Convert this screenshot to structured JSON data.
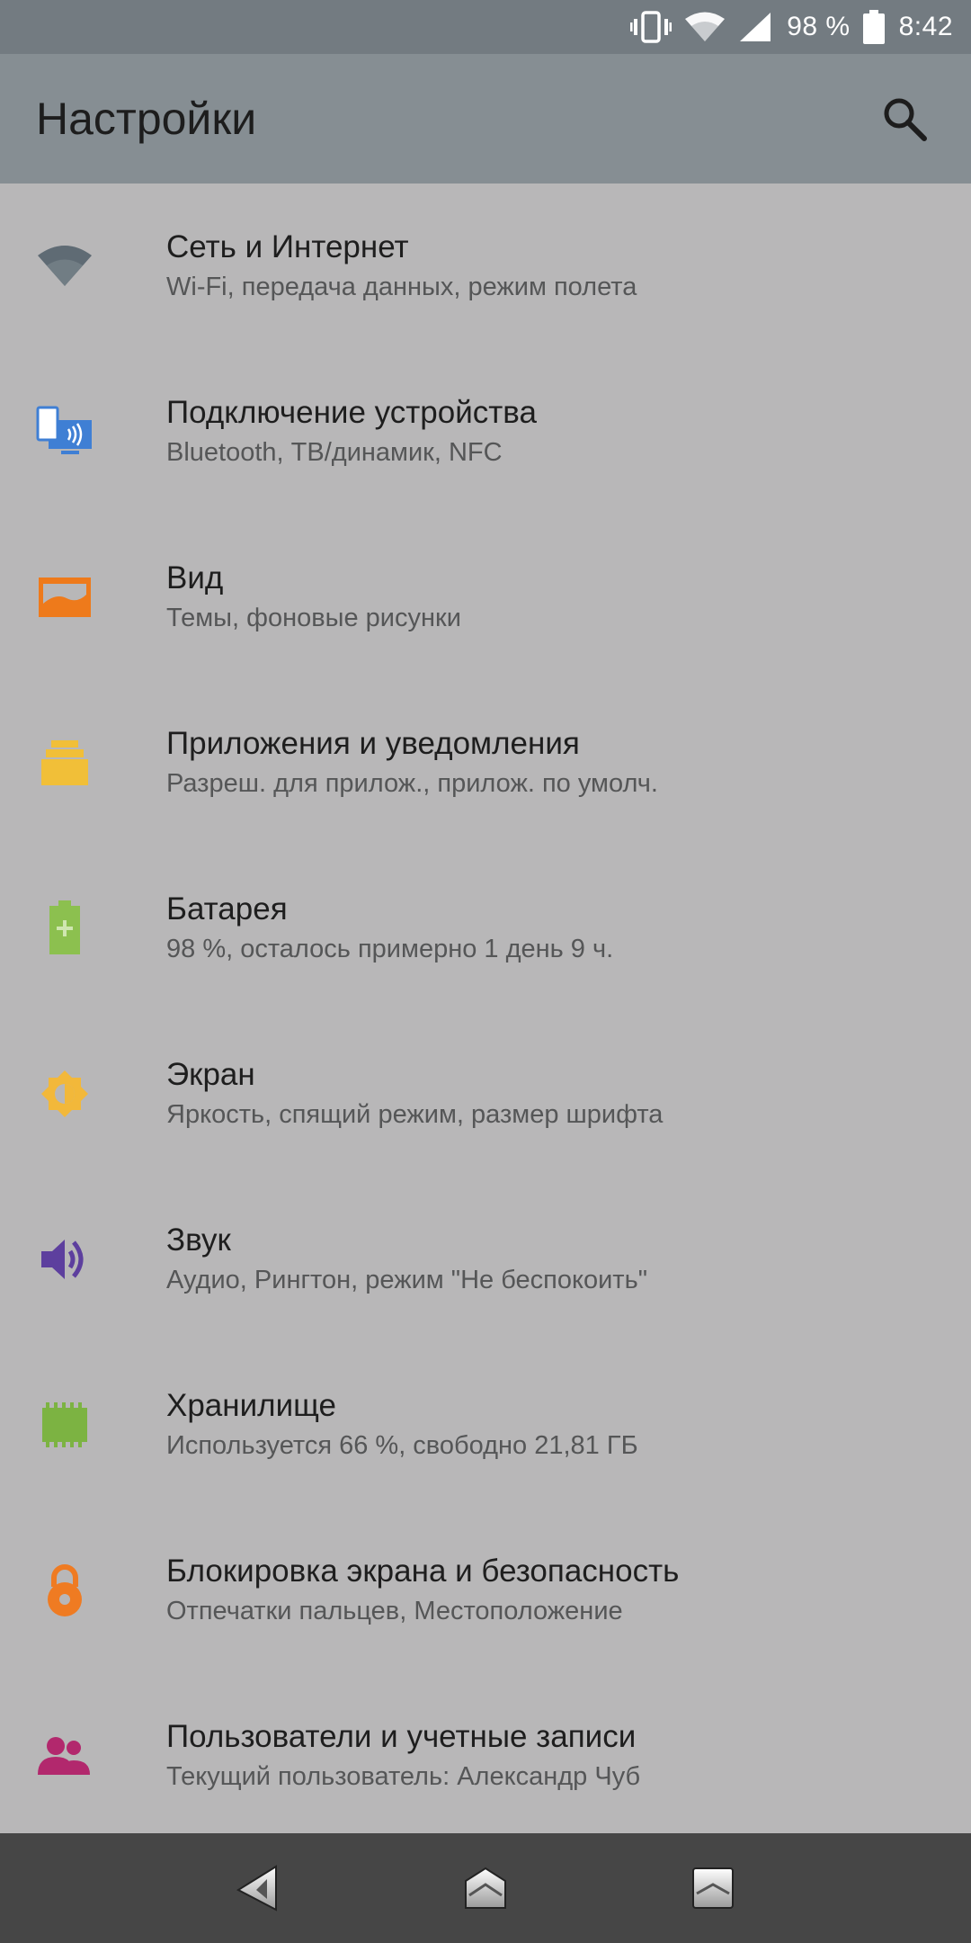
{
  "status_bar": {
    "battery_percent": "98 %",
    "time": "8:42",
    "icons": [
      "vibrate-icon",
      "wifi-icon",
      "signal-icon",
      "battery-icon"
    ],
    "battery_level": 0.98
  },
  "app_bar": {
    "title": "Настройки",
    "search_icon": "search-icon"
  },
  "settings": [
    {
      "title": "Сеть и Интернет",
      "subtitle": "Wi-Fi, передача данных, режим полета",
      "icon": "wifi-icon",
      "color": "#5f6b74"
    },
    {
      "title": "Подключение устройства",
      "subtitle": "Bluetooth, ТВ/динамик, NFC",
      "icon": "devices-icon",
      "color": "#3f7fd4"
    },
    {
      "title": "Вид",
      "subtitle": "Темы, фоновые рисунки",
      "icon": "wallpaper-icon",
      "color": "#ee7a1b"
    },
    {
      "title": "Приложения и уведомления",
      "subtitle": "Разреш. для прилож., прилож. по умолч.",
      "icon": "apps-icon",
      "color": "#f1bf38"
    },
    {
      "title": "Батарея",
      "subtitle": "98 %, осталось примерно 1 день 9 ч.",
      "icon": "battery-icon",
      "color": "#8cc04f"
    },
    {
      "title": "Экран",
      "subtitle": "Яркость, спящий режим, размер шрифта",
      "icon": "brightness-icon",
      "color": "#f2b83a"
    },
    {
      "title": "Звук",
      "subtitle": "Аудио, Рингтон, режим \"Не беспокоить\"",
      "icon": "volume-icon",
      "color": "#5d3f9e"
    },
    {
      "title": "Хранилище",
      "subtitle": "Используется 66 %, свободно 21,81 ГБ",
      "icon": "storage-icon",
      "color": "#7cb342"
    },
    {
      "title": "Блокировка экрана и безопасность",
      "subtitle": "Отпечатки пальцев, Местоположение",
      "icon": "lock-icon",
      "color": "#ef7b22"
    },
    {
      "title": "Пользователи и учетные записи",
      "subtitle": "Текущий пользователь: Александр Чуб",
      "icon": "accounts-icon",
      "color": "#b2286d"
    }
  ],
  "nav_bar": {
    "buttons": [
      "back-icon",
      "home-icon",
      "recents-icon"
    ]
  }
}
